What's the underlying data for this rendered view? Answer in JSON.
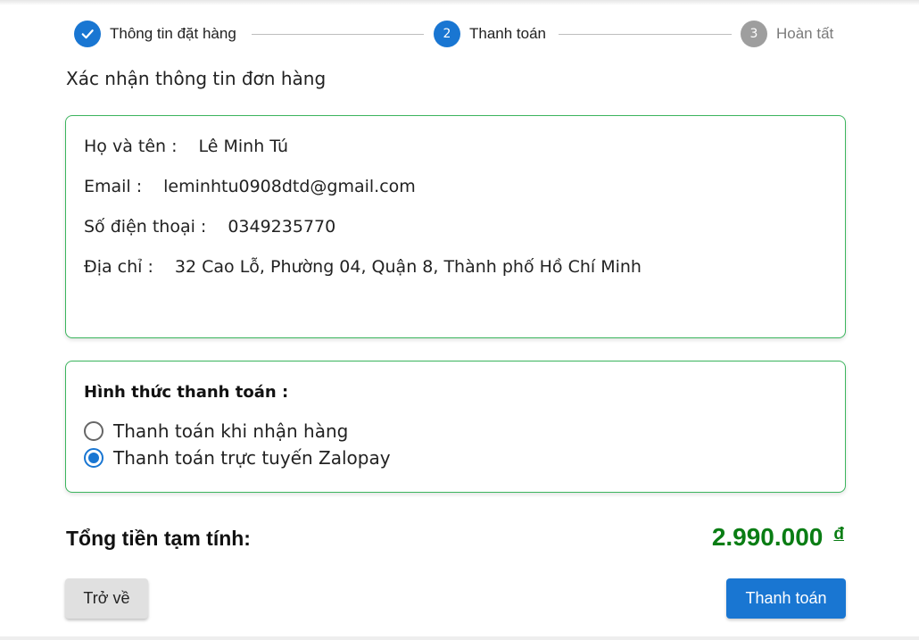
{
  "stepper": {
    "steps": [
      {
        "label": "Thông tin đặt hàng",
        "state": "done",
        "number": "1"
      },
      {
        "label": "Thanh toán",
        "state": "active",
        "number": "2"
      },
      {
        "label": "Hoàn tất",
        "state": "pending",
        "number": "3"
      }
    ]
  },
  "section_title": "Xác nhận thông tin đơn hàng",
  "customer": {
    "name_label": "Họ và tên :",
    "name": "Lê Minh Tú",
    "email_label": "Email :",
    "email": "leminhtu0908dtd@gmail.com",
    "phone_label": "Số điện thoại :",
    "phone": "0349235770",
    "address_label": "Địa chỉ :",
    "address": "32 Cao Lỗ, Phường 04, Quận 8, Thành phố Hồ Chí Minh"
  },
  "payment": {
    "title": "Hình thức thanh toán :",
    "options": [
      {
        "label": "Thanh toán khi nhận hàng",
        "selected": false
      },
      {
        "label": "Thanh toán trực tuyến Zalopay",
        "selected": true
      }
    ]
  },
  "total": {
    "label": "Tổng tiền tạm tính:",
    "amount": "2.990.000",
    "currency": "đ",
    "color": "#0a7d14"
  },
  "buttons": {
    "back_label": "Trở về",
    "pay_label": "Thanh toán"
  },
  "colors": {
    "primary": "#1976d2",
    "card_border": "#3cb55e",
    "step_pending": "#9e9e9e"
  },
  "icons": {
    "step_done": "check-icon"
  }
}
